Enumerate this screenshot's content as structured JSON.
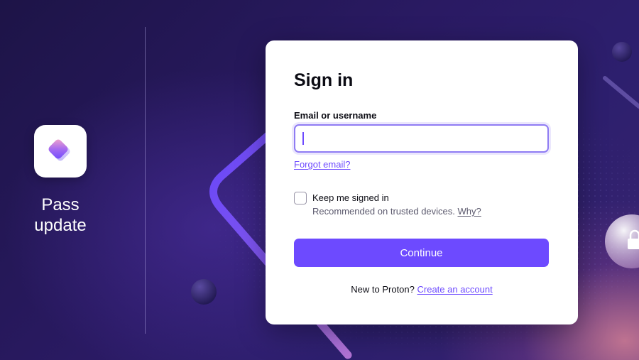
{
  "brand": {
    "line1": "Pass",
    "line2": "update",
    "icon": "proton-pass-icon"
  },
  "signin": {
    "title": "Sign in",
    "email_label": "Email or username",
    "email_value": "",
    "forgot_link": "Forgot email?",
    "keep_signed_in_label": "Keep me signed in",
    "keep_signed_in_checked": false,
    "keep_hint": "Recommended on trusted devices.",
    "why_link": "Why?",
    "continue_label": "Continue",
    "new_prompt": "New to Proton?",
    "create_link": "Create an account"
  },
  "colors": {
    "accent": "#6d4aff",
    "background": "#211650",
    "card": "#ffffff"
  }
}
